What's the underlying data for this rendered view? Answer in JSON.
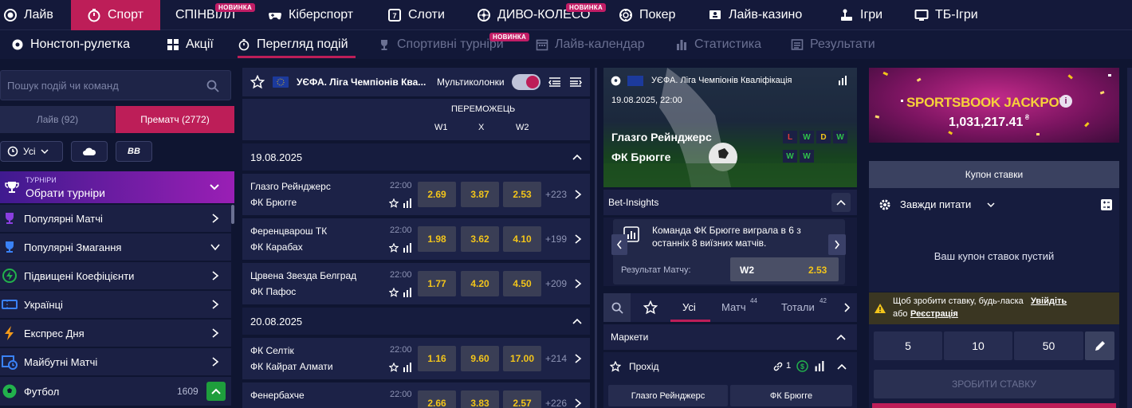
{
  "top_nav": {
    "items": [
      {
        "label": "Лайв",
        "icon": "live-icon"
      },
      {
        "label": "Спорт",
        "icon": "stopwatch-icon",
        "active": true
      },
      {
        "label": "СПІНВІЛЛ",
        "badge": "НОВИНКА"
      },
      {
        "label": "Кіберспорт",
        "icon": "gamepad-icon"
      },
      {
        "label": "Слоти",
        "icon": "slot-icon"
      },
      {
        "label": "ДИВО-КОЛЕСО",
        "icon": "wheel-icon",
        "badge": "НОВИНКА"
      },
      {
        "label": "Покер",
        "icon": "poker-chip-icon"
      },
      {
        "label": "Лайв-казино",
        "icon": "dealer-icon"
      },
      {
        "label": "Ігри",
        "icon": "joystick-icon"
      },
      {
        "label": "ТБ-Ігри",
        "icon": "tv-icon"
      }
    ]
  },
  "sub_nav": {
    "items": [
      {
        "label": "Нонстоп-рулетка"
      },
      {
        "label": "Акції"
      },
      {
        "label": "Перегляд подій",
        "active": true
      },
      {
        "label": "Спортивні турніри",
        "badge": "НОВИНКА"
      },
      {
        "label": "Лайв-календар"
      },
      {
        "label": "Статистика"
      },
      {
        "label": "Результати"
      }
    ]
  },
  "left": {
    "search_placeholder": "Пошук подій чи команд",
    "tab_live": "Лайв (92)",
    "tab_prematch": "Прематч (2772)",
    "filter_all": "Усі",
    "tournaments_caption": "ТУРНІРИ",
    "tournaments_title": "Обрати турніри",
    "menu": [
      {
        "label": "Популярні Матчі"
      },
      {
        "label": "Популярні Змагання"
      },
      {
        "label": "Підвищені Коефіцієнти"
      },
      {
        "label": "Українці"
      },
      {
        "label": "Експрес Дня"
      },
      {
        "label": "Майбутні Матчі"
      },
      {
        "label": "Футбол",
        "count": "1609"
      }
    ]
  },
  "center": {
    "league": "УЄФА. Ліга Чемпіонів Ква...",
    "multicolumns": "Мультиколонки",
    "market_title": "ПЕРЕМОЖЕЦЬ",
    "col_w1": "W1",
    "col_x": "X",
    "col_w2": "W2",
    "groups": [
      {
        "date": "19.08.2025",
        "matches": [
          {
            "home": "Глазго Рейнджерс",
            "away": "ФК Брюгге",
            "time": "22:00",
            "w1": "2.69",
            "x": "3.87",
            "w2": "2.53",
            "more": "+223"
          },
          {
            "home": "Ференцварош ТК",
            "away": "ФК Карабах",
            "time": "22:00",
            "w1": "1.98",
            "x": "3.62",
            "w2": "4.10",
            "more": "+199"
          },
          {
            "home": "Црвена Звезда Белград",
            "away": "ФК Пафос",
            "time": "22:00",
            "w1": "1.77",
            "x": "4.20",
            "w2": "4.50",
            "more": "+209"
          }
        ]
      },
      {
        "date": "20.08.2025",
        "matches": [
          {
            "home": "ФК Селтік",
            "away": "ФК Кайрат Алмати",
            "time": "22:00",
            "w1": "1.16",
            "x": "9.60",
            "w2": "17.00",
            "more": "+214"
          },
          {
            "home": "Фенербахче",
            "away": "",
            "time": "22:00",
            "w1": "2.66",
            "x": "3.83",
            "w2": "2.57",
            "more": "+226"
          }
        ]
      }
    ]
  },
  "event": {
    "league": "УЄФА. Ліга Чемпіонів Кваліфікація",
    "datetime": "19.08.2025, 22:00",
    "home": "Глазго Рейнджерс",
    "away": "ФК Брюгге",
    "form_home": [
      "L",
      "W",
      "D",
      "W"
    ],
    "form_away": [
      "W",
      "W"
    ],
    "insights_title": "Bet-Insights",
    "insight_text": "Команда ФК Брюгге виграла в 6 з останніх 8 виїзних матчів.",
    "result_label": "Результат Матчу:",
    "result_pick": "W2",
    "result_odd": "2.53",
    "tabs": [
      {
        "label": "Усі",
        "active": true
      },
      {
        "label": "Матч",
        "sup": "44"
      },
      {
        "label": "Тотали",
        "sup": "42"
      }
    ],
    "markets_title": "Маркети",
    "market_name": "Прохід",
    "market_links": "1",
    "pass_home": "Глазго Рейнджерс",
    "pass_away": "ФК Брюгге"
  },
  "coupon": {
    "jackpot_title": "SPORTSBOOK JACKPOT",
    "jackpot_amount": "1,031,217.41",
    "jackpot_currency": "₴",
    "header": "Купон ставки",
    "always_ask": "Завжди питати",
    "empty": "Ваш купон ставок пустий",
    "warn_text": "Щоб зробити ставку, будь-ласка",
    "warn_login": "Увійдіть",
    "warn_or": "або",
    "warn_register": "Реєстрація",
    "stakes": [
      "5",
      "10",
      "50"
    ],
    "place_bet": "ЗРОБИТИ СТАВКУ"
  },
  "colors": {
    "accent": "#bd1e58",
    "odds": "#f3c51a",
    "bg": "#0f1531",
    "panel": "#1b2044"
  }
}
